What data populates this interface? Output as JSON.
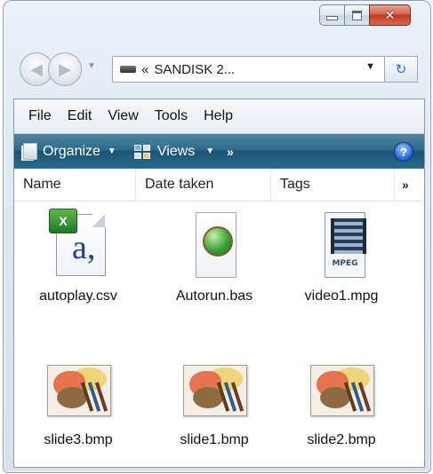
{
  "window": {
    "caption_buttons": {
      "minimize_icon": "minimize-icon",
      "maximize_icon": "maximize-icon",
      "close_glyph": "✕"
    }
  },
  "navigation": {
    "back_glyph": "◀",
    "forward_glyph": "▶",
    "dropdown_glyph": "▼",
    "address_chevron": "«",
    "address_text": "SANDISK 2...",
    "address_dropdown_glyph": "▼",
    "refresh_glyph": "↻"
  },
  "menubar": {
    "items": [
      "File",
      "Edit",
      "View",
      "Tools",
      "Help"
    ]
  },
  "toolbar": {
    "organize_label": "Organize",
    "views_label": "Views",
    "caret": "▼",
    "more": "»",
    "help": "?"
  },
  "columns": {
    "name": "Name",
    "date": "Date taken",
    "tags": "Tags",
    "more": "»"
  },
  "files": [
    {
      "name": "autoplay.csv",
      "icon": "csv-icon",
      "badge": "X",
      "letter": "a,"
    },
    {
      "name": "Autorun.bas",
      "icon": "bas-icon"
    },
    {
      "name": "video1.mpg",
      "icon": "mpeg-icon",
      "format": "MPEG"
    },
    {
      "name": "slide3.bmp",
      "icon": "bmp-icon"
    },
    {
      "name": "slide1.bmp",
      "icon": "bmp-icon"
    },
    {
      "name": "slide2.bmp",
      "icon": "bmp-icon"
    }
  ],
  "colors": {
    "toolbar": "#2f6a8b",
    "close_button": "#c23b22",
    "frame": "#dfe7f0"
  }
}
